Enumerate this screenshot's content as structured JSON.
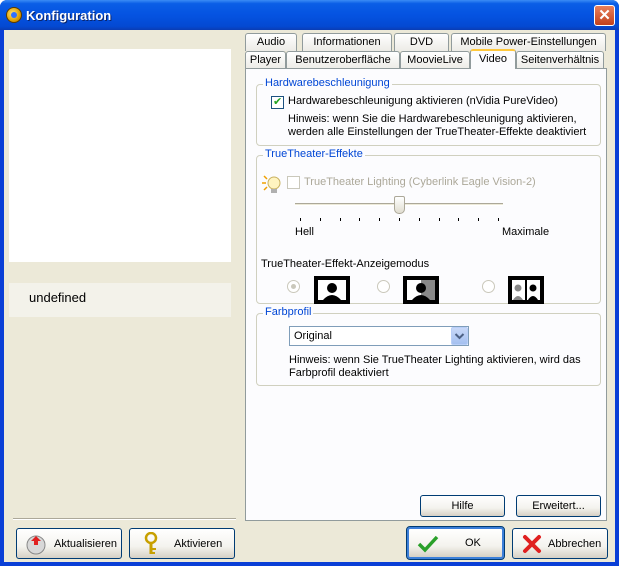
{
  "window": {
    "title": "Konfiguration",
    "close_symbol": "✕"
  },
  "left": {
    "item_label": "undefined"
  },
  "bottom_left": {
    "refresh_label": "Aktualisieren",
    "activate_label": "Aktivieren"
  },
  "tabs_row1": [
    "Audio",
    "Informationen",
    "DVD",
    "Mobile Power-Einstellungen"
  ],
  "tabs_row2": [
    "Player",
    "Benutzeroberfläche",
    "MoovieLive",
    "Video",
    "Seitenverhältnis"
  ],
  "active_tab": "Video",
  "hardware": {
    "group_label": "Hardwarebeschleunigung",
    "checkbox_label": "Hardwarebeschleunigung aktivieren (nVidia PureVideo)",
    "checked": true,
    "hint_line1": "Hinweis: wenn Sie die Hardwarebeschleunigung aktivieren,",
    "hint_line2": "werden alle Einstellungen der TrueTheater-Effekte deaktiviert"
  },
  "truetheater": {
    "group_label": "TrueTheater-Effekte",
    "lighting_label": "TrueTheater Lighting (Cyberlink Eagle Vision-2)",
    "lighting_checked": false,
    "slider_min_label": "Hell",
    "slider_max_label": "Maximale",
    "slider_value": 0.5,
    "mode_label": "TrueTheater-Effekt-Anzeigemodus",
    "mode_selected": 0
  },
  "colorprofile": {
    "group_label": "Farbprofil",
    "selected": "Original",
    "hint_line1": "Hinweis: wenn Sie TrueTheater Lighting aktivieren, wird das",
    "hint_line2": "Farbprofil deaktiviert"
  },
  "panel_buttons": {
    "help_label": "Hilfe",
    "advanced_label": "Erweitert..."
  },
  "dialog_buttons": {
    "ok_label": "OK",
    "cancel_label": "Abbrechen"
  }
}
